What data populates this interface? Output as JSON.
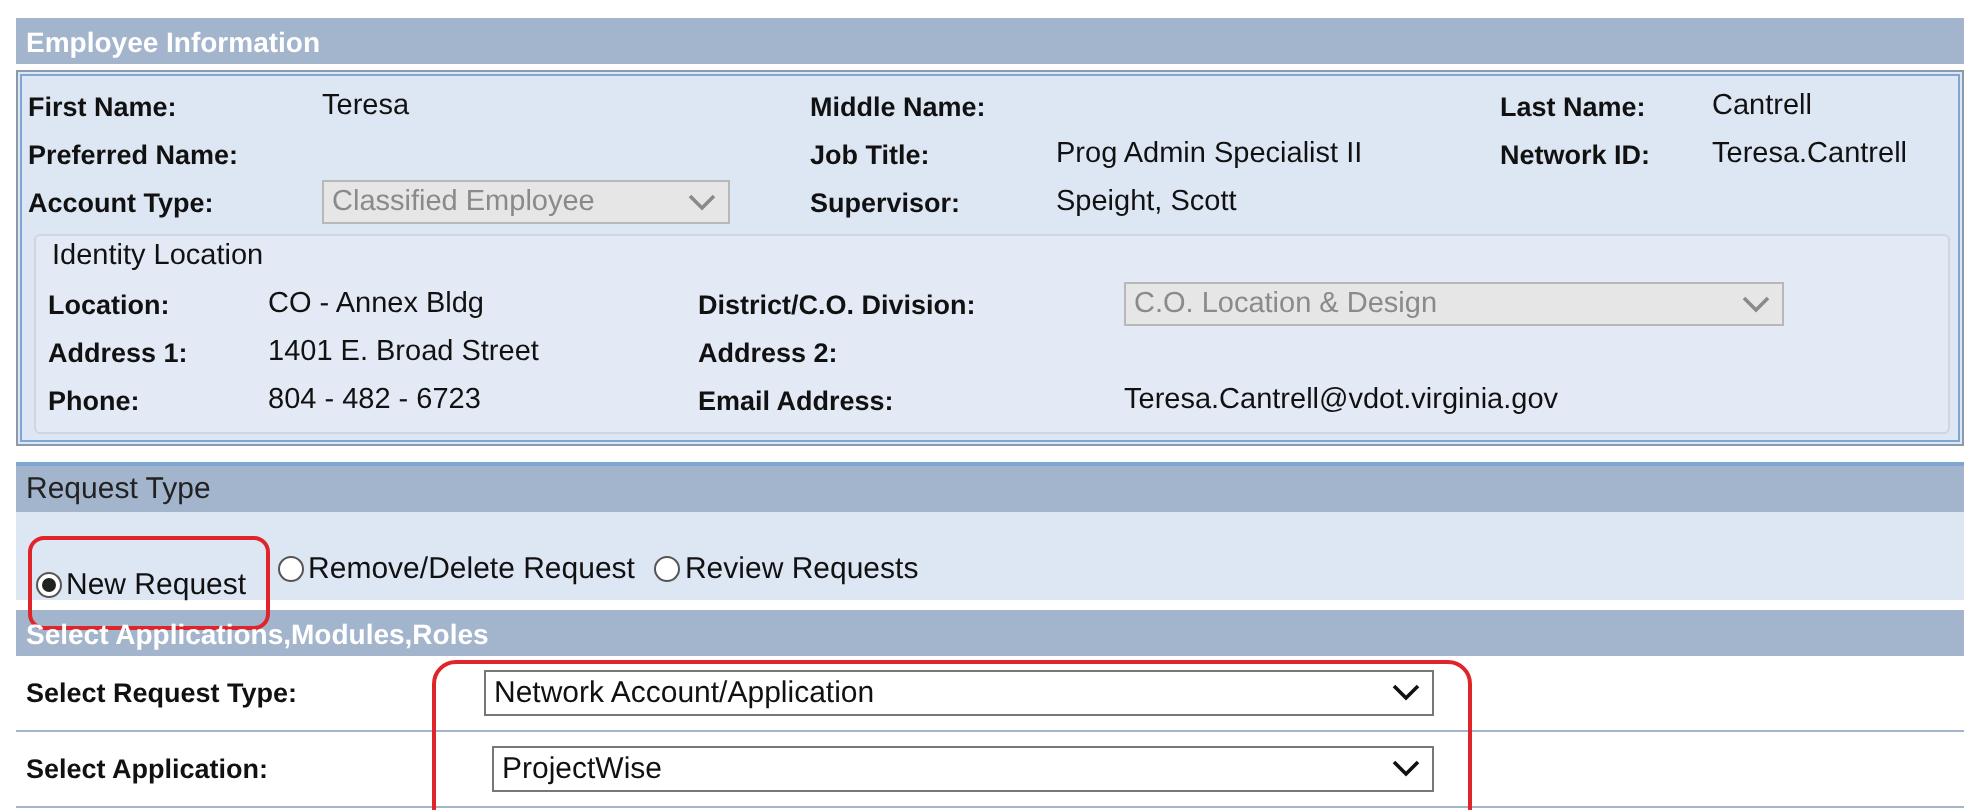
{
  "employee_information": {
    "title": "Employee Information",
    "rows": [
      [
        {
          "label": "First Name:",
          "value": "Teresa"
        },
        {
          "label": "Middle Name:"
        },
        {
          "label": "Last Name:",
          "value": "Cantrell"
        }
      ],
      [
        {
          "label": "Preferred Name:"
        },
        {
          "label": "Job Title:",
          "value": "Prog Admin Specialist II"
        },
        {
          "label": "Network ID:",
          "value": "Teresa.Cantrell"
        }
      ],
      [
        {
          "label": "Account Type:",
          "kind": "select",
          "value": "Classified Employee",
          "disabled": true
        },
        {
          "label": "Supervisor:",
          "value": "Speight, Scott"
        }
      ]
    ],
    "identity_location": {
      "title": "Identity Location",
      "rows": [
        [
          {
            "label": "Location:",
            "value": "CO - Annex Bldg"
          },
          {
            "label": "District/C.O. Division:",
            "kind": "select",
            "value": "C.O. Location & Design",
            "disabled": true
          }
        ],
        [
          {
            "label": "Address 1:",
            "value": "1401 E. Broad Street"
          },
          {
            "label": "Address 2:"
          }
        ],
        [
          {
            "label": "Phone:",
            "value": "804 - 482 - 6723"
          },
          {
            "label": "Email Address:",
            "value": "Teresa.Cantrell@vdot.virginia.gov"
          }
        ]
      ]
    }
  },
  "request_type": {
    "title": "Request Type",
    "options": [
      {
        "label": "New Request",
        "selected": true,
        "highlighted": true
      },
      {
        "label": "Remove/Delete Request",
        "selected": false,
        "highlighted": false
      },
      {
        "label": "Review Requests",
        "selected": false,
        "highlighted": false
      }
    ]
  },
  "select_applications": {
    "title": "Select Applications,Modules,Roles",
    "highlighted": true,
    "fields": [
      {
        "label": "Select Request Type:",
        "value": "Network Account/Application"
      },
      {
        "label": "Select Application:",
        "value": "ProjectWise"
      }
    ]
  }
}
